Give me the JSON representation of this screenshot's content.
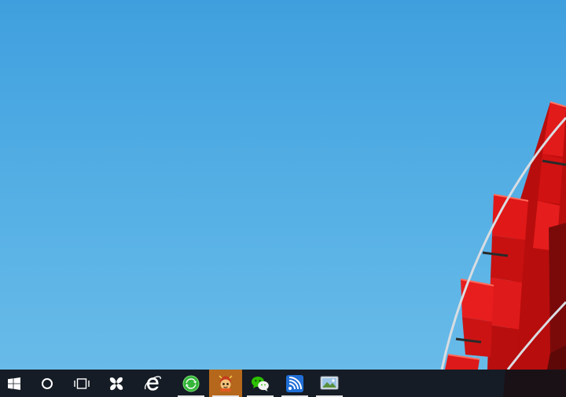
{
  "desktop": {
    "wallpaper": "sky-and-red-building-facade",
    "sky_color": "#4aa8e2",
    "facade_color": "#d81414"
  },
  "taskbar": {
    "background_color": "#101218",
    "active_color": "#b5671c",
    "start": {
      "icon": "windows-logo-icon"
    },
    "search": {
      "icon": "cortana-circle-icon"
    },
    "task_view": {
      "icon": "task-view-icon"
    },
    "apps": [
      {
        "icon": "pinwheel-app-icon",
        "running": false,
        "active": false
      },
      {
        "icon": "internet-explorer-icon",
        "running": false,
        "active": false
      },
      {
        "icon": "green-refresh-app-icon",
        "running": true,
        "active": false
      },
      {
        "icon": "character-app-icon",
        "running": true,
        "active": true
      },
      {
        "icon": "wechat-icon",
        "running": true,
        "active": false
      },
      {
        "icon": "wifi-broadcast-icon",
        "running": true,
        "active": false
      },
      {
        "icon": "photo-viewer-icon",
        "running": true,
        "active": false
      }
    ]
  }
}
